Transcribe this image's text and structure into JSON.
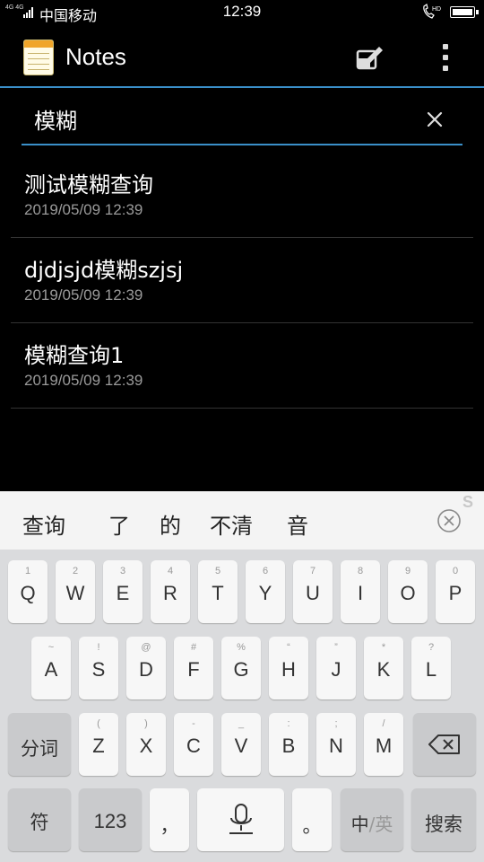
{
  "status_bar": {
    "network": "4G 4G",
    "carrier": "中国移动",
    "time": "12:39",
    "call_badge": "HD"
  },
  "app_bar": {
    "title": "Notes",
    "icons": [
      "notes-app-icon",
      "compose-icon",
      "more-options-icon"
    ]
  },
  "search": {
    "value": "模糊",
    "clear_icon": "close-icon"
  },
  "notes": [
    {
      "title": "测试模糊查询",
      "date": "2019/05/09 12:39"
    },
    {
      "title": "djdjsjd模糊szjsj",
      "date": "2019/05/09 12:39"
    },
    {
      "title": "模糊查询1",
      "date": "2019/05/09 12:39"
    }
  ],
  "candidates": {
    "items": [
      "查询",
      "了",
      "的",
      "不清",
      "音"
    ],
    "close_icon": "circle-close-icon",
    "mark": "S"
  },
  "keyboard": {
    "row1": [
      {
        "main": "Q",
        "hint": "1"
      },
      {
        "main": "W",
        "hint": "2"
      },
      {
        "main": "E",
        "hint": "3"
      },
      {
        "main": "R",
        "hint": "4"
      },
      {
        "main": "T",
        "hint": "5"
      },
      {
        "main": "Y",
        "hint": "6"
      },
      {
        "main": "U",
        "hint": "7"
      },
      {
        "main": "I",
        "hint": "8"
      },
      {
        "main": "O",
        "hint": "9"
      },
      {
        "main": "P",
        "hint": "0"
      }
    ],
    "row2": [
      {
        "main": "A",
        "hint": "~"
      },
      {
        "main": "S",
        "hint": "!"
      },
      {
        "main": "D",
        "hint": "@"
      },
      {
        "main": "F",
        "hint": "#"
      },
      {
        "main": "G",
        "hint": "%"
      },
      {
        "main": "H",
        "hint": "“"
      },
      {
        "main": "J",
        "hint": "”"
      },
      {
        "main": "K",
        "hint": "*"
      },
      {
        "main": "L",
        "hint": "?"
      }
    ],
    "row3": [
      {
        "main": "Z",
        "hint": "("
      },
      {
        "main": "X",
        "hint": ")"
      },
      {
        "main": "C",
        "hint": "-"
      },
      {
        "main": "V",
        "hint": "_"
      },
      {
        "main": "B",
        "hint": ":"
      },
      {
        "main": "N",
        "hint": ";"
      },
      {
        "main": "M",
        "hint": "/"
      }
    ],
    "fenci_label": "分词",
    "backspace_icon": "backspace-icon",
    "symbol_label": "符",
    "num_label": "123",
    "comma_label": "，",
    "mic_icon": "microphone-icon",
    "period_label": "。",
    "lang_cn": "中",
    "lang_sep": "/",
    "lang_en": "英",
    "search_label": "搜索"
  },
  "colors": {
    "accent": "#3a8fc9",
    "background": "#000000",
    "keyboard_bg": "#dadbdd"
  }
}
